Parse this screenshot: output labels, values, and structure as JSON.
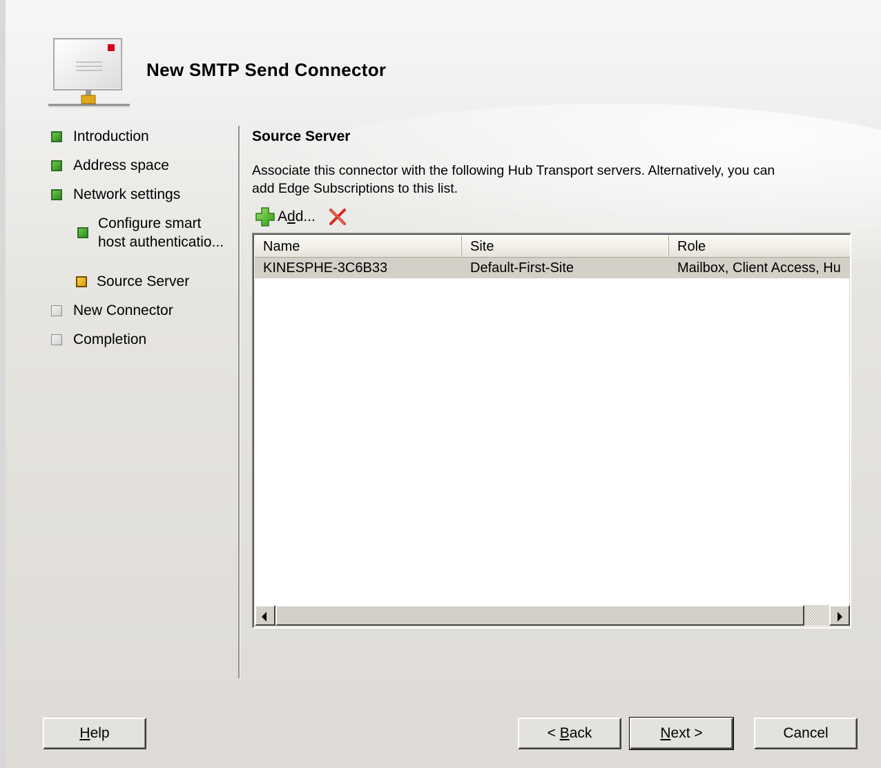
{
  "window": {
    "title": "New SMTP Send Connector"
  },
  "steps": [
    {
      "label": "Introduction",
      "state": "done"
    },
    {
      "label": "Address space",
      "state": "done"
    },
    {
      "label": "Network settings",
      "state": "done"
    },
    {
      "label_line1": "Configure smart",
      "label_line2": "host authenticatio...",
      "state": "done"
    },
    {
      "label": "Source Server",
      "state": "current"
    },
    {
      "label": "New Connector",
      "state": "pending"
    },
    {
      "label": "Completion",
      "state": "pending"
    }
  ],
  "main": {
    "section_title": "Source Server",
    "description_line1": "Associate this connector with the following Hub Transport servers. Alternatively, you can",
    "description_line2": "add Edge Subscriptions to this list.",
    "toolbar": {
      "add_prefix": "A",
      "add_underlined": "d",
      "add_suffix": "d...",
      "add_icon": "add-plus-icon",
      "remove_icon": "remove-x-icon"
    },
    "table": {
      "columns": [
        "Name",
        "Site",
        "Role"
      ],
      "rows": [
        [
          "KINESPHE-3C6B33",
          "Default-First-Site",
          "Mailbox, Client Access, Hu"
        ]
      ]
    }
  },
  "footer": {
    "help": {
      "u": "H",
      "rest": "elp"
    },
    "back": {
      "pre": "< ",
      "u": "B",
      "rest": "ack"
    },
    "next": {
      "u": "N",
      "rest": "ext >"
    },
    "cancel": "Cancel"
  },
  "colors": {
    "done": "#3a9e24",
    "current": "#e5a910",
    "pending": "#cfcfcf",
    "selected_row": "#d4d0c8"
  }
}
